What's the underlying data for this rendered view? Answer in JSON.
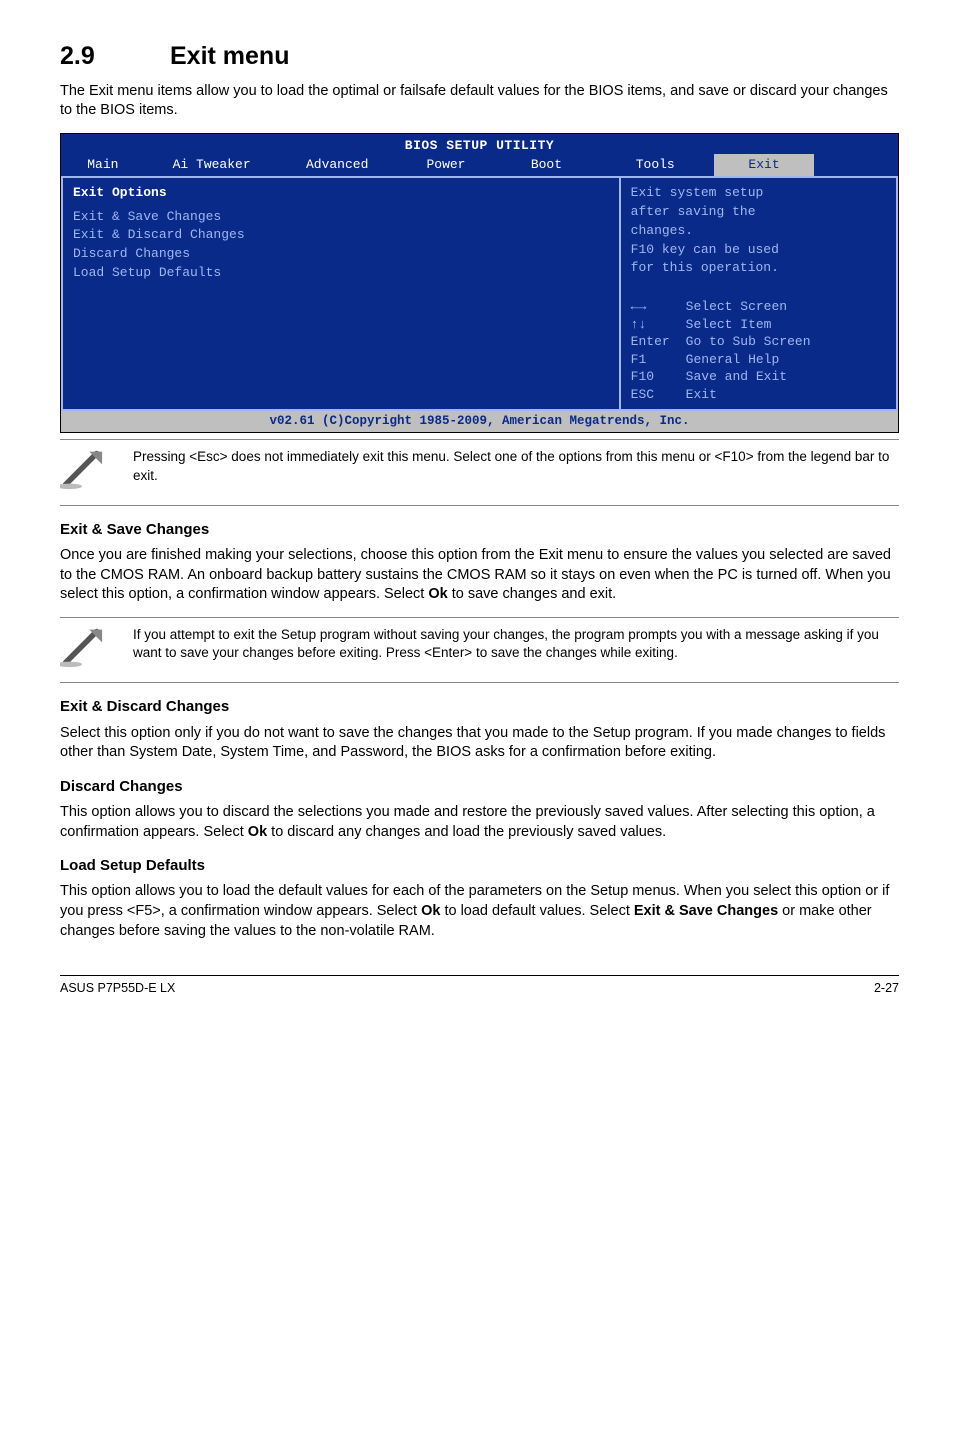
{
  "heading": {
    "number": "2.9",
    "title": "Exit menu"
  },
  "intro": "The Exit menu items allow you to load the optimal or failsafe default values for the BIOS items, and save or discard your changes to the BIOS items.",
  "bios": {
    "title": "BIOS SETUP UTILITY",
    "tabs": [
      "Main",
      "Ai Tweaker",
      "Advanced",
      "Power",
      "Boot",
      "Tools",
      "Exit"
    ],
    "active_tab_index": 6,
    "left": {
      "header": "Exit Options",
      "options": [
        "Exit & Save Changes",
        "Exit & Discard Changes",
        "Discard Changes",
        "",
        "Load Setup Defaults"
      ]
    },
    "right": {
      "help": [
        "Exit system setup",
        "after saving the",
        "changes.",
        "",
        "F10 key can be used",
        "for this operation."
      ],
      "keys": [
        {
          "key": "←→",
          "label": "Select Screen"
        },
        {
          "key": "↑↓",
          "label": "Select Item"
        },
        {
          "key": "Enter",
          "label": "Go to Sub Screen"
        },
        {
          "key": "F1",
          "label": "General Help"
        },
        {
          "key": "F10",
          "label": "Save and Exit"
        },
        {
          "key": "ESC",
          "label": "Exit"
        }
      ]
    },
    "footer": "v02.61 (C)Copyright 1985-2009, American Megatrends, Inc."
  },
  "note1": "Pressing <Esc> does not immediately exit this menu. Select one of the options from this menu or <F10> from the legend bar to exit.",
  "sections": {
    "save": {
      "title": "Exit & Save Changes",
      "body": "Once you are finished making your selections, choose this option from the Exit menu to ensure the values you selected are saved to the CMOS RAM. An onboard backup battery sustains the CMOS RAM so it stays on even when the PC is turned off. When you select this option, a confirmation window appears. Select Ok to save changes and exit.",
      "note": "If you attempt to exit the Setup program without saving your changes, the program prompts you with a message asking if you want to save your changes before exiting. Press <Enter> to save the changes while exiting."
    },
    "discard_exit": {
      "title": "Exit & Discard Changes",
      "body": "Select this option only if you do not want to save the changes that you made to the Setup program. If you made changes to fields other than System Date, System Time, and Password, the BIOS asks for a confirmation before exiting."
    },
    "discard": {
      "title": "Discard Changes",
      "body": "This option allows you to discard the selections you made and restore the previously saved values. After selecting this option, a confirmation appears. Select Ok to discard any changes and load the previously saved values."
    },
    "defaults": {
      "title": "Load Setup Defaults",
      "body": "This option allows you to load the default values for each of the parameters on the Setup menus. When you select this option or if you press <F5>, a confirmation window appears. Select Ok to load default values. Select Exit & Save Changes or make other changes before saving the values to the non-volatile RAM."
    }
  },
  "footer": {
    "left": "ASUS P7P55D-E LX",
    "right": "2-27"
  }
}
